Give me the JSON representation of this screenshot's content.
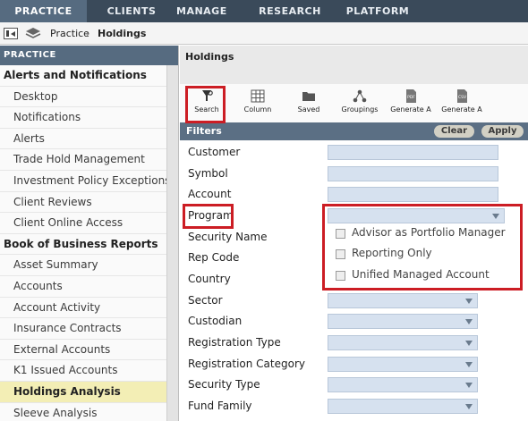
{
  "topnav": {
    "tabs": [
      {
        "label": "PRACTICE",
        "active": true
      },
      {
        "label": "CLIENTS",
        "active": false
      },
      {
        "label": "MANAGE",
        "active": false
      },
      {
        "label": "RESEARCH",
        "active": false
      },
      {
        "label": "PLATFORM",
        "active": false
      }
    ]
  },
  "breadcrumb": {
    "root": "Practice",
    "current": "Holdings"
  },
  "sidebar": {
    "header": "PRACTICE",
    "items": [
      {
        "label": "Alerts and Notifications",
        "type": "group"
      },
      {
        "label": "Desktop",
        "type": "item"
      },
      {
        "label": "Notifications",
        "type": "item"
      },
      {
        "label": "Alerts",
        "type": "item"
      },
      {
        "label": "Trade Hold Management",
        "type": "item"
      },
      {
        "label": "Investment Policy Exceptions",
        "type": "item"
      },
      {
        "label": "Client Reviews",
        "type": "item"
      },
      {
        "label": "Client Online Access",
        "type": "item"
      },
      {
        "label": "Book of Business Reports",
        "type": "group"
      },
      {
        "label": "Asset Summary",
        "type": "item"
      },
      {
        "label": "Accounts",
        "type": "item"
      },
      {
        "label": "Account Activity",
        "type": "item"
      },
      {
        "label": "Insurance Contracts",
        "type": "item"
      },
      {
        "label": "External Accounts",
        "type": "item"
      },
      {
        "label": "K1 Issued Accounts",
        "type": "item"
      },
      {
        "label": "Holdings Analysis",
        "type": "item",
        "selected": true
      },
      {
        "label": "Sleeve Analysis",
        "type": "item"
      }
    ]
  },
  "main": {
    "title": "Holdings",
    "toolbar": [
      {
        "label": "Search",
        "icon": "search-funnel-icon"
      },
      {
        "label": "Column",
        "icon": "column-grid-icon"
      },
      {
        "label": "Saved",
        "icon": "folder-icon"
      },
      {
        "label": "Groupings",
        "icon": "groupings-icon"
      },
      {
        "label": "Generate A",
        "icon": "pdf-icon",
        "badge": "PDF"
      },
      {
        "label": "Generate A",
        "icon": "csv-icon",
        "badge": "CSV"
      }
    ],
    "filters": {
      "title": "Filters",
      "clear_label": "Clear",
      "apply_label": "Apply",
      "fields": {
        "customer": "Customer",
        "symbol": "Symbol",
        "account": "Account",
        "program": "Program",
        "security_name": "Security Name",
        "rep_code": "Rep Code",
        "country": "Country",
        "sector": "Sector",
        "custodian": "Custodian",
        "registration_type": "Registration Type",
        "registration_category": "Registration Category",
        "security_type": "Security Type",
        "fund_family": "Fund Family"
      },
      "program_options": [
        "Advisor as Portfolio Manager",
        "Reporting Only",
        "Unified Managed Account"
      ]
    }
  },
  "colors": {
    "highlight": "#cc1d24",
    "nav": "#3a4a5a",
    "input": "#d6e1ef",
    "selected": "#f3eeb5"
  }
}
